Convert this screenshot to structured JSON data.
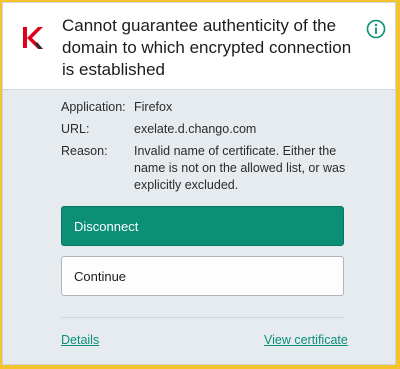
{
  "header": {
    "title": "Cannot guarantee authenticity of the domain to which encrypted connection is established"
  },
  "details": {
    "application": {
      "label": "Application:",
      "value": "Firefox"
    },
    "url": {
      "label": "URL:",
      "value": "exelate.d.chango.com"
    },
    "reason": {
      "label": "Reason:",
      "value": "Invalid name of certificate. Either the name is not on the allowed list, or was explicitly excluded."
    }
  },
  "actions": {
    "disconnect_label": "Disconnect",
    "continue_label": "Continue"
  },
  "links": {
    "details_label": "Details",
    "view_certificate_label": "View certificate"
  },
  "colors": {
    "accent": "#0b8f77",
    "brand_red": "#e0001a",
    "window_frame": "#f5c32c"
  },
  "icons": {
    "logo": "kaspersky-logo-icon",
    "info": "info-icon"
  }
}
